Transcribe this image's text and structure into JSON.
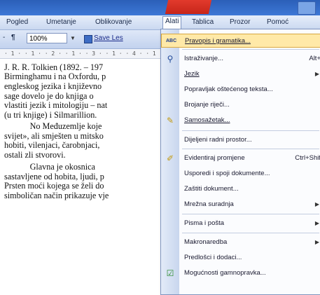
{
  "titlebar": {
    "title": ""
  },
  "menubar": {
    "items": [
      "Pogled",
      "Umetanje",
      "Oblikovanje",
      "Alati",
      "Tablica",
      "Prozor",
      "Pomoć"
    ],
    "extra": "Pomoć"
  },
  "toolbar": {
    "zoom": "100%",
    "save": "Save Les"
  },
  "ruler": {
    "text": "⋅ 1 ⋅ ⋅ 1 ⋅ ⋅ 2 ⋅ ⋅ 1 ⋅ ⋅ 3 ⋅ ⋅ 1 ⋅ ⋅ 4 ⋅ ⋅ 1"
  },
  "document": {
    "lines": [
      "J. R. R. Tolkien (1892. – 197",
      "Birminghamu i na Oxfordu, p",
      "engleskog jezika i književno",
      "sage dovelo je do knjiga o",
      "vlastiti jezik i mitologiju – nat",
      "(u tri knjige) i Silmarillion.",
      "            No Međuzemlje koje",
      "svijet», ali smješten u mitsko",
      "hobiti, vilenjaci, čarobnjaci,",
      "ostali zli stvorovi.",
      "            Glavna je okosnica",
      "sastavljene od hobita, ljudi, p",
      "Prsten moći kojega se želi do",
      "simboličan način prikazuje vje"
    ]
  },
  "menu": {
    "items": [
      {
        "icon": "spelling-icon",
        "glyph": "ABC",
        "label": "Pravopis i gramatika...",
        "shortcut": ""
      },
      {
        "icon": "research-icon",
        "glyph": "🔍",
        "label": "Istraživanje...",
        "shortcut": "Alt+"
      },
      {
        "icon": "",
        "glyph": "",
        "label": "Jezik",
        "shortcut": ""
      },
      {
        "icon": "",
        "glyph": "",
        "label": "Popravljak oštećenog teksta...",
        "shortcut": ""
      },
      {
        "icon": "",
        "glyph": "",
        "label": "Brojanje riječi...",
        "shortcut": ""
      },
      {
        "icon": "autosummary-icon",
        "glyph": "✎",
        "label": "Samosažetak...",
        "shortcut": ""
      },
      {
        "icon": "",
        "glyph": "",
        "label": "Dijeljeni radni prostor...",
        "shortcut": ""
      },
      {
        "icon": "track-changes-icon",
        "glyph": "✐",
        "label": "Evidentiraj promjene",
        "shortcut": "Ctrl+Shif"
      },
      {
        "icon": "",
        "glyph": "",
        "label": "Usporedi i spoji dokumente...",
        "shortcut": ""
      },
      {
        "icon": "",
        "glyph": "",
        "label": "Zaštiti dokument...",
        "shortcut": ""
      },
      {
        "icon": "",
        "glyph": "",
        "label": "Mrežna suradnja",
        "shortcut": ""
      },
      {
        "icon": "",
        "glyph": "",
        "label": "Pisma i pošta",
        "shortcut": ""
      },
      {
        "icon": "",
        "glyph": "",
        "label": "Makronaredba",
        "shortcut": ""
      },
      {
        "icon": "",
        "glyph": "",
        "label": "Predlošci i dodaci...",
        "shortcut": ""
      },
      {
        "icon": "options-icon",
        "glyph": "☑",
        "label": "Mogućnosti gamnopravka...",
        "shortcut": ""
      }
    ]
  },
  "colors": {
    "menu_highlight": "#ffe9a8",
    "menubar": "#cad8f0",
    "titlebar": "#3d78d6"
  }
}
